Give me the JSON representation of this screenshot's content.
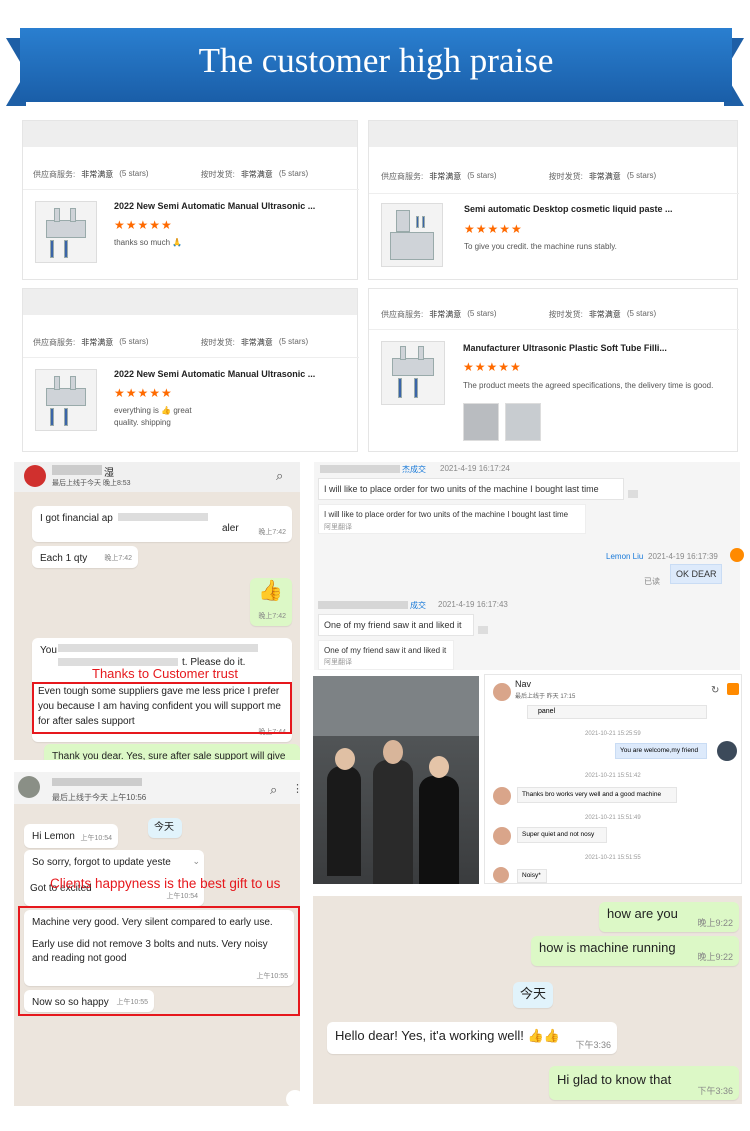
{
  "banner": {
    "title": "The customer high praise"
  },
  "reviews": [
    {
      "supplier_label": "供应商服务:",
      "supplier_value": "非常满意",
      "supplier_stars": "(5 stars)",
      "shipping_label": "按时发货:",
      "shipping_value": "非常满意",
      "shipping_stars": "(5 stars)",
      "title": "2022 New Semi Automatic Manual Ultrasonic ...",
      "stars": "★★★★★",
      "text": "thanks so much 🙏"
    },
    {
      "supplier_label": "供应商服务:",
      "supplier_value": "非常满意",
      "supplier_stars": "(5 stars)",
      "shipping_label": "按时发货:",
      "shipping_value": "非常满意",
      "shipping_stars": "(5 stars)",
      "title": "Semi automatic Desktop cosmetic liquid paste ...",
      "stars": "★★★★★",
      "text": "To give you credit. the machine runs stably."
    },
    {
      "supplier_label": "供应商服务:",
      "supplier_value": "非常满意",
      "supplier_stars": "(5 stars)",
      "shipping_label": "按时发货:",
      "shipping_value": "非常满意",
      "shipping_stars": "(5 stars)",
      "title": "2022 New Semi Automatic Manual Ultrasonic ...",
      "stars": "★★★★★",
      "text1": "everything is 👍 great",
      "text2": "quality.  shipping"
    },
    {
      "supplier_label": "供应商服务:",
      "supplier_value": "非常满意",
      "supplier_stars": "(5 stars)",
      "shipping_label": "按时发货:",
      "shipping_value": "非常满意",
      "shipping_stars": "(5 stars)",
      "title": "Manufacturer Ultrasonic Plastic Soft Tube Filli...",
      "stars": "★★★★★",
      "text": "The product meets the agreed specifications, the delivery time is good."
    }
  ],
  "chat1": {
    "name": "湿",
    "status": "最后上线于今天 晚上8:53",
    "msgs": [
      {
        "text": "I got financial ap",
        "tail": "aler",
        "time": "晚上7:42"
      },
      {
        "text": "Each 1 qty",
        "time": "晚上7:42"
      },
      {
        "text": "👍",
        "time": "晚上7:42"
      },
      {
        "text": "You",
        "tail": "t. Please do it.",
        "time": ""
      },
      {
        "text": "Even tough some suppliers gave me less price I prefer you because I am having confident you will support me for after sales support",
        "time": "晚上7:44"
      },
      {
        "text": "Thank you dear. Yes, sure after sale support will give you"
      }
    ],
    "annotation": "Thanks to Customer trust"
  },
  "chat2": {
    "msg1_name": "杰成交",
    "msg1_time": "2021-4-19 16:17:24",
    "msg1": "I will like to place order for two units of the machine I bought last time",
    "msg1_quote": "I will like to place order for two units of the machine I bought last time",
    "translate": "阿里翻译",
    "reply_name": "Lemon Liu",
    "reply_time": "2021-4-19 16:17:39",
    "reply_status": "已读",
    "reply": "OK DEAR",
    "msg2_name": "成交",
    "msg2_time": "2021-4-19 16:17:43",
    "msg2": "One of my friend saw it and liked it",
    "msg2_quote": "One of my friend saw it and liked it",
    "translate2": "阿里翻译"
  },
  "chat3": {
    "name": "Nav",
    "status": "最后上线于 昨天 17:15",
    "msgs": [
      {
        "text": "panel",
        "time": "2021-10-21 15:25:59"
      },
      {
        "text": "You are welcome,my friend",
        "time": "2021-10-21 15:51:42"
      },
      {
        "text": "Thanks bro works very well and a good machine",
        "time": "2021-10-21 15:51:49"
      },
      {
        "text": "Super quiet and not nosy",
        "time": "2021-10-21 15:51:55"
      },
      {
        "text": "Noisy*"
      }
    ]
  },
  "chat4": {
    "status": "最后上线于今天 上午10:56",
    "date": "今天",
    "msgs": [
      {
        "text": "Hi Lemon",
        "time": "上午10:54"
      },
      {
        "text": "So sorry, forgot to update yeste",
        "time": ""
      },
      {
        "text": "Got to excited",
        "time": "上午10:54"
      },
      {
        "text": "Machine very good. Very silent compared to early use.",
        "time": ""
      },
      {
        "text": "Early use did not remove 3 bolts and nuts. Very noisy and reading not good",
        "time": "上午10:55"
      },
      {
        "text": "Now so so happy",
        "time": "上午10:55"
      }
    ],
    "annotation": "Clients happyness is the best gift to us"
  },
  "chat5": {
    "date": "今天",
    "msgs": [
      {
        "text": "how are you",
        "time": "晚上9:22"
      },
      {
        "text": "how is machine running",
        "time": "晚上9:22"
      },
      {
        "text": "Hello dear! Yes, it'a working well! 👍👍",
        "time": "下午3:36"
      },
      {
        "text": "Hi glad to know that",
        "time": "下午3:36"
      }
    ]
  },
  "colors": {
    "banner": "#1a5ea8",
    "accent_red": "#e6181d",
    "star": "#ff6a00",
    "wa_out": "#dcf8c6",
    "wa_bg": "#ece5dd"
  }
}
